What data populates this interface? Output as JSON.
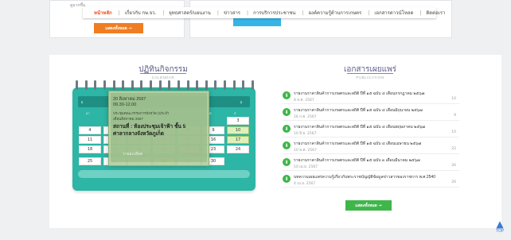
{
  "top": {
    "more_label": "แสดงทั้งหมด →",
    "side_text": "ดูมากขึ้น"
  },
  "nav": {
    "items": [
      {
        "label": "หน้าหลัก"
      },
      {
        "label": "เกี่ยวกับ กษ.จว."
      },
      {
        "label": "ยุทธศาสตร์/แผนงาน"
      },
      {
        "label": "ข่าวสาร"
      },
      {
        "label": "การบริการประชาชน"
      },
      {
        "label": "องค์ความรู้ด้านการเกษตร"
      },
      {
        "label": "เอกสารดาวน์โหลด"
      },
      {
        "label": "ติดต่อเรา"
      }
    ]
  },
  "activities": {
    "title": "ปฏิทินกิจกรรม",
    "subtitle": "CALENDAR"
  },
  "calendar": {
    "days_of_week": [
      "อา",
      "จ",
      "อ",
      "พ",
      "พฤ",
      "ศ",
      "ส"
    ],
    "rows": [
      [
        "",
        "",
        "",
        "",
        "",
        "",
        "3"
      ],
      [
        "4",
        "5",
        "6",
        "7",
        "8",
        "9",
        "10"
      ],
      [
        "11",
        "12",
        "13",
        "14",
        "15",
        "16",
        "17"
      ],
      [
        "18",
        "19",
        "20",
        "21",
        "22",
        "23",
        "24"
      ],
      [
        "25",
        "26",
        "27",
        "28",
        "29",
        "30",
        ""
      ]
    ],
    "prev_label": "‹",
    "next_label": "›"
  },
  "popup": {
    "date": "20 สิงหาคม 2567",
    "time": "09.30-12.00",
    "line3": "ประชุมคณะกรรมการจังหวัด (ประจำ",
    "line4": "เดือนสิงหาคม 2567",
    "location_line1": "สถานที่ : ห้องประชุมเจ้าฟ้า ชั้น 5",
    "location_line2": "ศาลากลางจังหวัดภูเก็ต",
    "details_link": "รายละเอียด"
  },
  "publications": {
    "title": "เอกสารเผยแพร่",
    "subtitle": "PUBLICATION",
    "items": [
      {
        "title": "รายงานราคาสินค้าการเกษตรและสถิติ ปีที่ ๑๕ ฉบับ ๔ เดือนกรกฎาคม ๒๕๖๗",
        "date": "8 ส.ค. 2567",
        "count": "10"
      },
      {
        "title": "รายงานราคาสินค้าการเกษตรและสถิติ ปีที่ ๑๕ ฉบับ ๔ เดือนมิถุนายน ๒๕๖๗",
        "date": "16 ก.ค. 2567",
        "count": "9"
      },
      {
        "title": "รายงานราคาสินค้าการเกษตรและสถิติ ปีที่ ๑๕ ฉบับ ๔ เดือนพฤษภาคม ๒๕๖๗",
        "date": "10 มิ.ย. 2567",
        "count": "10"
      },
      {
        "title": "รายงานราคาสินค้าการเกษตรและสถิติ ปีที่ ๑๕ ฉบับ ๔ เดือนเมษายน ๒๕๖๗",
        "date": "10 พ.ค. 2567",
        "count": "22"
      },
      {
        "title": "รายงานราคาสินค้าการเกษตรและสถิติ ปีที่ ๑๕ ฉบับ ๓ เดือนมีนาคม ๒๕๖๗",
        "date": "10 เม.ย. 2567",
        "count": "26"
      },
      {
        "title": "บทความเผยแพร่ความรู้เกี่ยวกับพระราชบัญญัติข้อมูลข่าวสารของราชการ พ.ศ.2540",
        "date": "4 เม.ย. 2567",
        "count": "26"
      }
    ],
    "more_label": "แสดงทั้งหมด →"
  },
  "scroll_top": {
    "arrow": "▲",
    "label": "TOP"
  },
  "colors": {
    "calendar_teal": "#2db5a5",
    "accent_orange": "#ef7d22",
    "accent_green": "#3fb649",
    "nav_active": "#e94e1b"
  }
}
